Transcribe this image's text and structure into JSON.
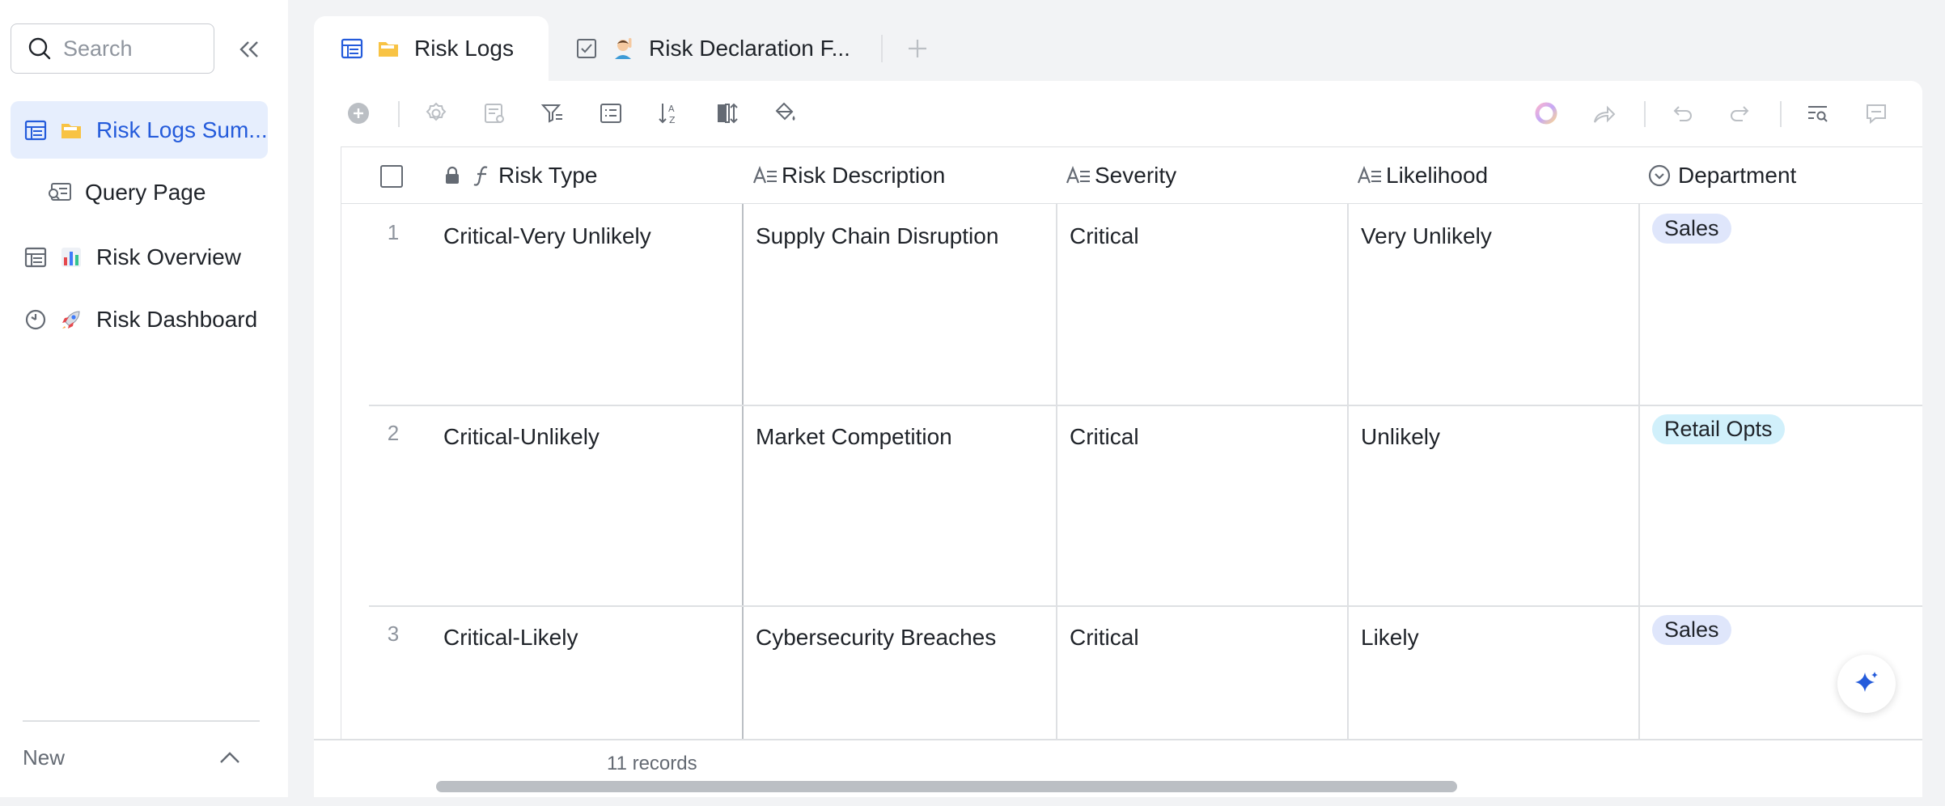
{
  "sidebar": {
    "search_placeholder": "Search",
    "items": [
      {
        "label": "Risk Logs Sum...",
        "icon": "grid-table-icon",
        "emoji": "📁",
        "active": true
      },
      {
        "label": "Query Page",
        "icon": "query-page-icon",
        "emoji": "",
        "active": false
      },
      {
        "label": "Risk Overview",
        "icon": "grid-table-icon",
        "emoji": "📊",
        "active": false
      },
      {
        "label": "Risk Dashboard",
        "icon": "dashboard-icon",
        "emoji": "🚀",
        "active": false
      }
    ],
    "new_label": "New"
  },
  "tabs": [
    {
      "label": "Risk Logs",
      "emoji": "📁",
      "icon": "grid-table-icon",
      "active": true
    },
    {
      "label": "Risk Declaration F...",
      "emoji": "🙋",
      "icon": "form-icon",
      "active": false
    }
  ],
  "table": {
    "columns": [
      {
        "label": "Risk Type",
        "icon": "formula-icon",
        "locked": true
      },
      {
        "label": "Risk Description",
        "icon": "text-field-icon"
      },
      {
        "label": "Severity",
        "icon": "text-field-icon"
      },
      {
        "label": "Likelihood",
        "icon": "text-field-icon"
      },
      {
        "label": "Department",
        "icon": "single-select-icon"
      }
    ],
    "rows": [
      {
        "num": "1",
        "risk_type": "Critical-Very Unlikely",
        "description": "Supply Chain Disruption",
        "severity": "Critical",
        "likelihood": "Very Unlikely",
        "department": "Sales"
      },
      {
        "num": "2",
        "risk_type": "Critical-Unlikely",
        "description": "Market Competition",
        "severity": "Critical",
        "likelihood": "Unlikely",
        "department": "Retail Opts"
      },
      {
        "num": "3",
        "risk_type": "Critical-Likely",
        "description": "Cybersecurity Breaches",
        "severity": "Critical",
        "likelihood": "Likely",
        "department": "Sales"
      }
    ],
    "record_count": "11 records"
  },
  "colors": {
    "accent": "#245bdb",
    "active_bg": "#e6eefd",
    "tag_sales": "#dfe6fb",
    "tag_retail": "#d1f0fb"
  }
}
